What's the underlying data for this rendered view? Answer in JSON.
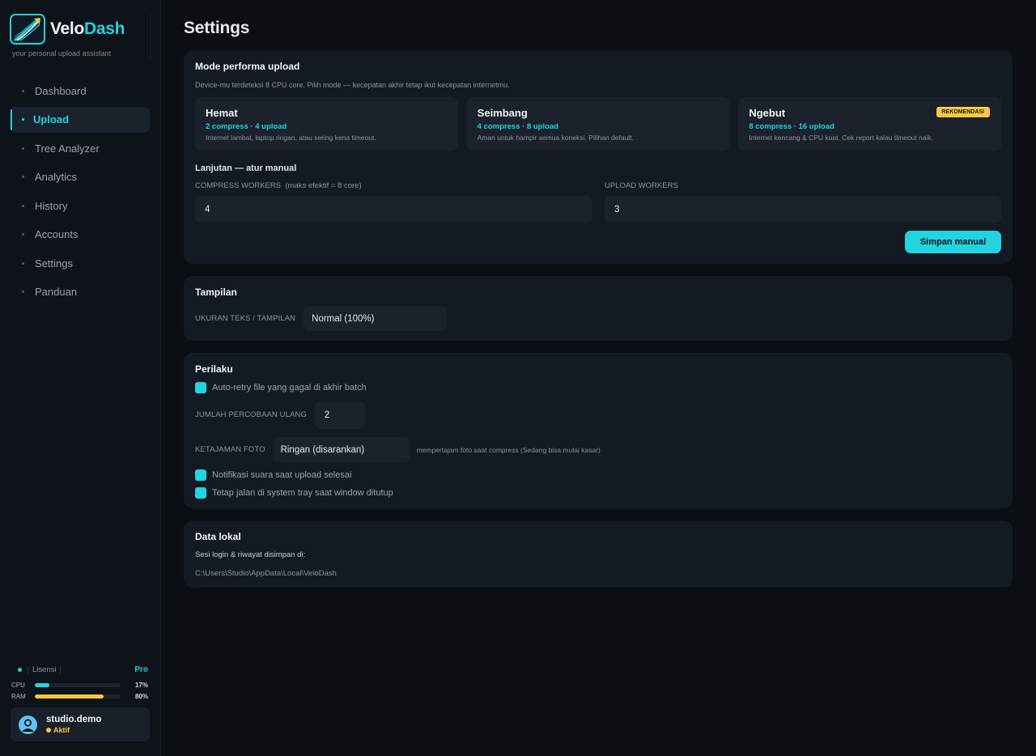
{
  "brand": {
    "name_part1": "Velo",
    "name_part2": "Dash",
    "tagline": "your personal upload assistant",
    "accent": "#22d3e0"
  },
  "nav": {
    "items": [
      {
        "label": "Dashboard"
      },
      {
        "label": "Upload"
      },
      {
        "label": "Tree Analyzer"
      },
      {
        "label": "Analytics"
      },
      {
        "label": "History"
      },
      {
        "label": "Accounts"
      },
      {
        "label": "Settings"
      },
      {
        "label": "Panduan"
      }
    ],
    "active": "Upload"
  },
  "license": {
    "label": "Lisensi",
    "tier": "Pro"
  },
  "meters": {
    "cpu": {
      "label": "CPU",
      "value": "17%",
      "fraction": 0.17,
      "color": "#22d3e0"
    },
    "ram": {
      "label": "RAM",
      "value": "80%",
      "fraction": 0.8,
      "color": "#f5c842"
    }
  },
  "user": {
    "name": "studio.demo",
    "status": "Aktif"
  },
  "page": {
    "title": "Settings"
  },
  "performance": {
    "title": "Mode performa upload",
    "desc": "Device-mu terdeteksi 8 CPU core. Pilih mode — kecepatan akhir tetap ikut kecepatan internetmu.",
    "modes": [
      {
        "name": "Hemat",
        "spec": "2 compress · 4 upload",
        "note": "Internet lambat, laptop ringan, atau sering kena timeout."
      },
      {
        "name": "Seimbang",
        "spec": "4 compress · 8 upload",
        "note": "Aman untuk hampir semua koneksi. Pilihan default."
      },
      {
        "name": "Ngebut",
        "spec": "8 compress · 16 upload",
        "note": "Internet kencang & CPU kuat. Cek report kalau timeout naik.",
        "badge": "REKOMENDASI"
      }
    ],
    "advanced_title": "Lanjutan — atur manual",
    "compress_label": "COMPRESS WORKERS  (maks efektif = 8 core)",
    "compress_value": "4",
    "upload_label": "UPLOAD WORKERS",
    "upload_value": "3",
    "save_label": "Simpan manual"
  },
  "display": {
    "title": "Tampilan",
    "size_label": "UKURAN TEKS / TAMPILAN",
    "size_value": "Normal (100%)"
  },
  "behavior": {
    "title": "Perilaku",
    "auto_retry": "Auto-retry file yang gagal di akhir batch",
    "retry_label": "JUMLAH PERCOBAAN ULANG",
    "retry_value": "2",
    "sharp_label": "KETAJAMAN FOTO",
    "sharp_value": "Ringan (disarankan)",
    "sharp_hint": "mempertajam foto saat compress (Sedang bisa mulai kasar)",
    "notify": "Notifikasi suara saat upload selesai",
    "tray": "Tetap jalan di system tray saat window ditutup"
  },
  "local": {
    "title": "Data lokal",
    "label": "Sesi login & riwayat disimpan di:",
    "path": "C:\\Users\\Studio\\AppData\\Local\\VeloDash"
  }
}
